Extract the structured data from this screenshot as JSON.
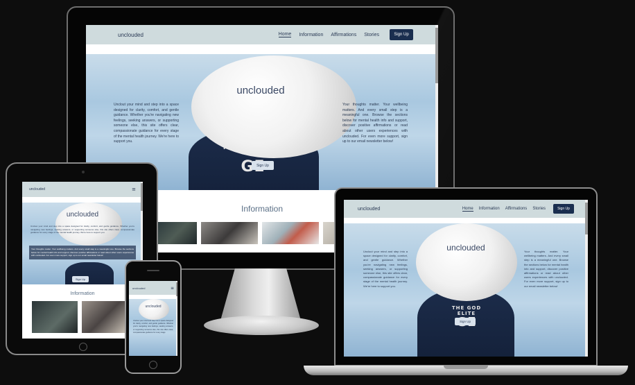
{
  "site": {
    "logo": "unclouded",
    "nav": [
      "Home",
      "Information",
      "Affirmations",
      "Stories"
    ],
    "signup": "Sign Up",
    "hero_title": "unclouded",
    "hero_button": "Sign Up",
    "hoodie_text": "THE GOD ELITE",
    "hoodie_mark": "GE",
    "intro_left": "Unclout your mind and step into a space designed for clarity, comfort, and gentle guidance. Whether you're navigating new feelings, seeking answers, or supporting someone else, this site offers clear, compassionate guidance for every stage of the mental health journey. We're here to support you.",
    "intro_right": "Your thoughts matter. Your wellbeing matters. And every small step is a meaningful one. Browse the sections below for mental health info and support, discover positive affirmations or read about other users experiences with unclouded. For even more support, sign up to our email newsletter below!",
    "laptop_intro_left": "Unclout your mind and step into a space designed for clarity, comfort, and gentle guidance. Whether you're navigating new feelings, seeking answers, or supporting someone else, this site offers clear, compassionate guidance for every stage of the mental health journey. We're here to support you.",
    "laptop_intro_right": "Your thoughts matter. Your wellbeing matters. And every small step is a meaningful one. Browse the sections below for mental health info and support, discover positive affirmations or read about other users experiences with unclouded. For even more support, sign up to our email newsletter below!",
    "tablet_intro": "Unclout your mind and step into a space designed for clarity, comfort, and gentle guidance. Whether you're navigating new feelings, seeking answers, or supporting someone else, this site offers clear, compassionate guidance for every stage of the mental health journey. We're here to support you.",
    "tablet_highlight": "Your thoughts matter. Your wellbeing matters. And every small step is a meaningful one. Browse the sections below for mental health info and support, discover positive affirmations or read about other users experiences with unclouded. For even more support, sign up to our email newsletter below!",
    "phone_intro": "Unclout your mind and step into a space designed for clarity, comfort, and gentle guidance. Whether you're navigating new feelings, seeking answers, or supporting someone else, this site offers clear, compassionate guidance for every stage",
    "info_heading": "Information",
    "hamburger": "≡"
  },
  "colors": {
    "navbar_bg": "#cfdbdd",
    "signup_bg": "#1a2e4f",
    "page_bg": "#0d0d0d"
  }
}
